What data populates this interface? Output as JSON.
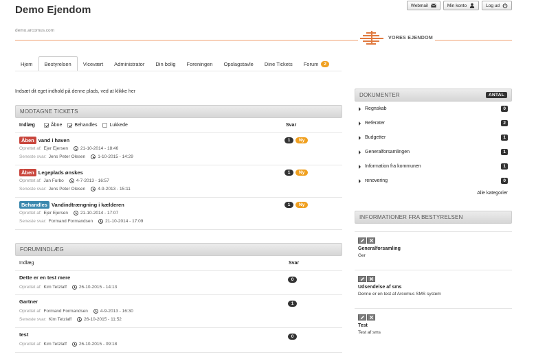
{
  "site": {
    "title": "Demo Ejendom",
    "domain": "demo.arcomus.com",
    "logo_text": "VORES EJENDOM"
  },
  "top_buttons": [
    {
      "label": "Webmail",
      "icon": "envelope-icon"
    },
    {
      "label": "Min konto",
      "icon": "user-icon"
    },
    {
      "label": "Log ud",
      "icon": "power-icon"
    }
  ],
  "nav": {
    "items": [
      {
        "label": "Hjem"
      },
      {
        "label": "Bestyrelsen",
        "active": true
      },
      {
        "label": "Vicevært"
      },
      {
        "label": "Administrator"
      },
      {
        "label": "Din bolig"
      },
      {
        "label": "Foreningen"
      },
      {
        "label": "Opslagstavle"
      },
      {
        "label": "Dine Tickets"
      },
      {
        "label": "Forum",
        "badge": "2"
      }
    ]
  },
  "intro_text": "Indsæt dit eget indhold på denne plads, ved at klikke her",
  "tickets": {
    "header": "MODTAGNE TICKETS",
    "col_post": "Indlæg",
    "col_replies": "Svar",
    "filters": [
      {
        "label": "Åbne",
        "checked": true
      },
      {
        "label": "Behandles",
        "checked": true
      },
      {
        "label": "Lukkede",
        "checked": false
      }
    ],
    "created_label": "Oprettet af:",
    "latest_label": "Seneste svar:",
    "items": [
      {
        "status": "Åben",
        "status_color": "#c9463d",
        "title": "vand i haven",
        "author": "Ejer Ejersen",
        "created": "21-10-2014 - 18:46",
        "last_by": "Jens Peter Olesen",
        "last_date": "1-10-2015 - 14:29",
        "replies": "1",
        "new": "Ny"
      },
      {
        "status": "Åben",
        "status_color": "#c9463d",
        "title": "Legeplads ønskes",
        "author": "Jan Furbo",
        "created": "4-7-2013 - 16:57",
        "last_by": "Jens Peter Olesen",
        "last_date": "4-9-2013 - 15:11",
        "replies": "1",
        "new": "Ny"
      },
      {
        "status": "Behandles",
        "status_color": "#3a87ad",
        "title": "Vandindtrængning i kælderen",
        "author": "Ejer Ejersen",
        "created": "21-10-2014 - 17:07",
        "last_by": "Formand Formandsen",
        "last_date": "21-10-2014 - 17:09",
        "replies": "1",
        "new": "Ny"
      }
    ]
  },
  "forum": {
    "header": "FORUMINDLÆG",
    "col_post": "Indlæg",
    "col_replies": "Svar",
    "items": [
      {
        "title": "Dette er en test mere",
        "author": "Kim Tetzlaff",
        "created": "26-10-2015 - 14:13",
        "replies": "0"
      },
      {
        "title": "Gartner",
        "author": "Formand Formandsen",
        "created": "4-9-2013 - 16:30",
        "last_by": "Kim Tetzlaff",
        "last_date": "26-10-2015 - 11:52",
        "replies": "1"
      },
      {
        "title": "test",
        "author": "Kim Tetzlaff",
        "created": "26-10-2015 - 09:18",
        "replies": "0"
      }
    ]
  },
  "documents": {
    "header": "DOKUMENTER",
    "count_label": "ANTAL",
    "items": [
      {
        "label": "Regnskab",
        "count": "0"
      },
      {
        "label": "Referater",
        "count": "2"
      },
      {
        "label": "Budgetter",
        "count": "1"
      },
      {
        "label": "Generalforsamlingen",
        "count": "1"
      },
      {
        "label": "Information fra kommunen",
        "count": "1"
      },
      {
        "label": "renovering",
        "count": "0"
      }
    ],
    "all_link": "Alle kategorier"
  },
  "board_info": {
    "header": "INFORMATIONER FRA BESTYRELSEN",
    "items": [
      {
        "title": "Generalforsamling",
        "body": "Ger"
      },
      {
        "title": "Udsendelse af sms",
        "body": "Denne er en test af Arcomus SMS system"
      },
      {
        "title": "Test",
        "body": "Test af sms"
      }
    ]
  }
}
